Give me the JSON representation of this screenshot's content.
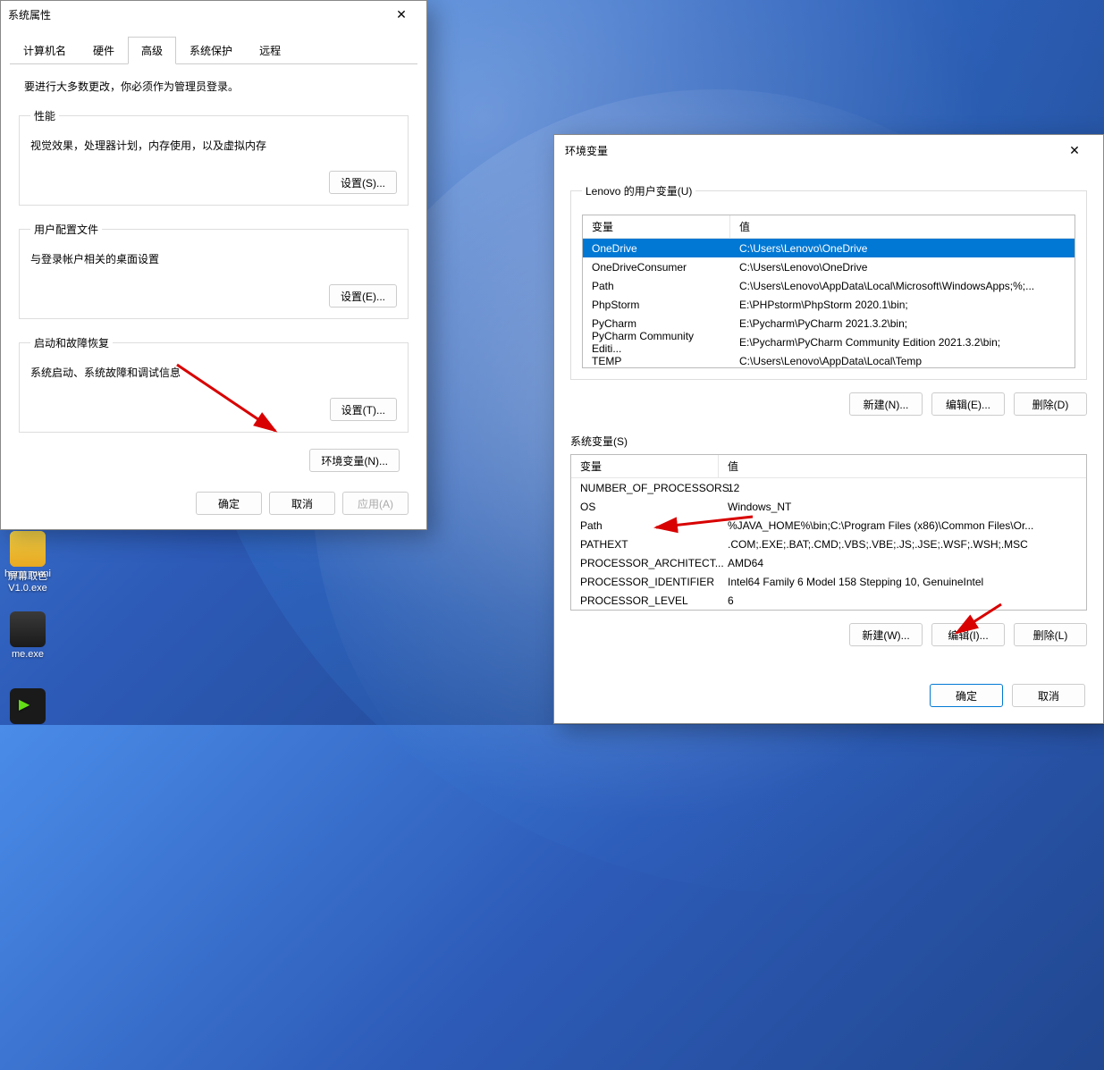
{
  "sysProps": {
    "title": "系统属性",
    "tabs": [
      "计算机名",
      "硬件",
      "高级",
      "系统保护",
      "远程"
    ],
    "activeTab": 2,
    "intro": "要进行大多数更改，你必须作为管理员登录。",
    "perf": {
      "legend": "性能",
      "desc": "视觉效果，处理器计划，内存使用，以及虚拟内存",
      "btn": "设置(S)..."
    },
    "userProfile": {
      "legend": "用户配置文件",
      "desc": "与登录帐户相关的桌面设置",
      "btn": "设置(E)..."
    },
    "startup": {
      "legend": "启动和故障恢复",
      "desc": "系统启动、系统故障和调试信息",
      "btn": "设置(T)..."
    },
    "envBtn": "环境变量(N)...",
    "ok": "确定",
    "cancel": "取消",
    "apply": "应用(A)"
  },
  "envDialog": {
    "title": "环境变量",
    "userVarsLegend": "Lenovo 的用户变量(U)",
    "colVar": "变量",
    "colVal": "值",
    "userVars": [
      {
        "name": "OneDrive",
        "value": "C:\\Users\\Lenovo\\OneDrive",
        "selected": true
      },
      {
        "name": "OneDriveConsumer",
        "value": "C:\\Users\\Lenovo\\OneDrive"
      },
      {
        "name": "Path",
        "value": "C:\\Users\\Lenovo\\AppData\\Local\\Microsoft\\WindowsApps;%;..."
      },
      {
        "name": "PhpStorm",
        "value": "E:\\PHPstorm\\PhpStorm 2020.1\\bin;"
      },
      {
        "name": "PyCharm",
        "value": "E:\\Pycharm\\PyCharm 2021.3.2\\bin;"
      },
      {
        "name": "PyCharm Community Editi...",
        "value": "E:\\Pycharm\\PyCharm Community Edition 2021.3.2\\bin;"
      },
      {
        "name": "TEMP",
        "value": "C:\\Users\\Lenovo\\AppData\\Local\\Temp"
      }
    ],
    "sysVarsLabel": "系统变量(S)",
    "sysVars": [
      {
        "name": "NUMBER_OF_PROCESSORS",
        "value": "12"
      },
      {
        "name": "OS",
        "value": "Windows_NT"
      },
      {
        "name": "Path",
        "value": "%JAVA_HOME%\\bin;C:\\Program Files (x86)\\Common Files\\Or..."
      },
      {
        "name": "PATHEXT",
        "value": ".COM;.EXE;.BAT;.CMD;.VBS;.VBE;.JS;.JSE;.WSF;.WSH;.MSC"
      },
      {
        "name": "PROCESSOR_ARCHITECT...",
        "value": "AMD64"
      },
      {
        "name": "PROCESSOR_IDENTIFIER",
        "value": "Intel64 Family 6 Model 158 Stepping 10, GenuineIntel"
      },
      {
        "name": "PROCESSOR_LEVEL",
        "value": "6"
      }
    ],
    "newBtn": "新建(N)...",
    "editBtn": "编辑(E)...",
    "deleteBtn": "删除(D)",
    "newBtn2": "新建(W)...",
    "editBtn2": "编辑(I)...",
    "deleteBtn2": "删除(L)",
    "ok": "确定",
    "cancel": "取消"
  },
  "desktopIcons": [
    {
      "label": "harm\nmuni"
    },
    {
      "label": "屏幕取色\nV1.0.exe"
    },
    {
      "label": "me.exe"
    }
  ]
}
